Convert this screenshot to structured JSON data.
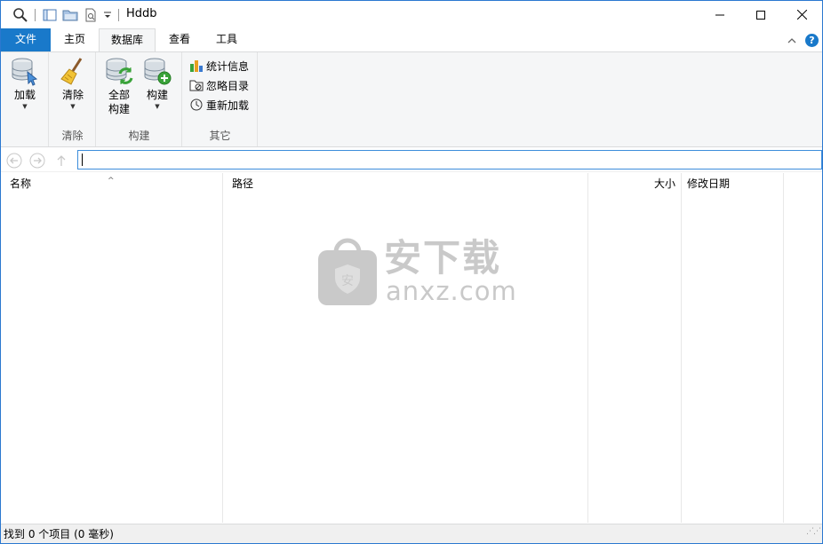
{
  "window": {
    "title": "Hddb"
  },
  "tabs": {
    "file": "文件",
    "home": "主页",
    "database": "数据库",
    "view": "查看",
    "tools": "工具"
  },
  "ribbon": {
    "load": {
      "label": "加载"
    },
    "clear": {
      "label": "清除",
      "group": "清除"
    },
    "build_all": {
      "line1": "全部",
      "line2": "构建"
    },
    "build": {
      "label": "构建",
      "group": "构建"
    },
    "other": {
      "group": "其它",
      "stats": "统计信息",
      "ignore": "忽略目录",
      "reload": "重新加载"
    }
  },
  "address": {
    "value": ""
  },
  "columns": {
    "name": "名称",
    "path": "路径",
    "size": "大小",
    "modified": "修改日期"
  },
  "watermark": {
    "big": "安下载",
    "small": "anxz.com",
    "badge": "安"
  },
  "status": {
    "text": "找到 0 个项目 (0 毫秒)"
  },
  "colors": {
    "accent": "#1979ca",
    "ribbon_bg": "#f5f6f7",
    "address_border": "#3c8ddb"
  },
  "icons": [
    "search-icon",
    "panel-icon",
    "folder-icon",
    "preview-icon",
    "dropdown-icon",
    "minimize-icon",
    "maximize-icon",
    "close-icon",
    "collapse-ribbon-icon",
    "help-icon",
    "database-load-icon",
    "broom-icon",
    "database-refresh-icon",
    "database-add-icon",
    "stats-chart-icon",
    "folder-ignore-icon",
    "reload-icon",
    "back-icon",
    "forward-icon",
    "up-icon"
  ]
}
